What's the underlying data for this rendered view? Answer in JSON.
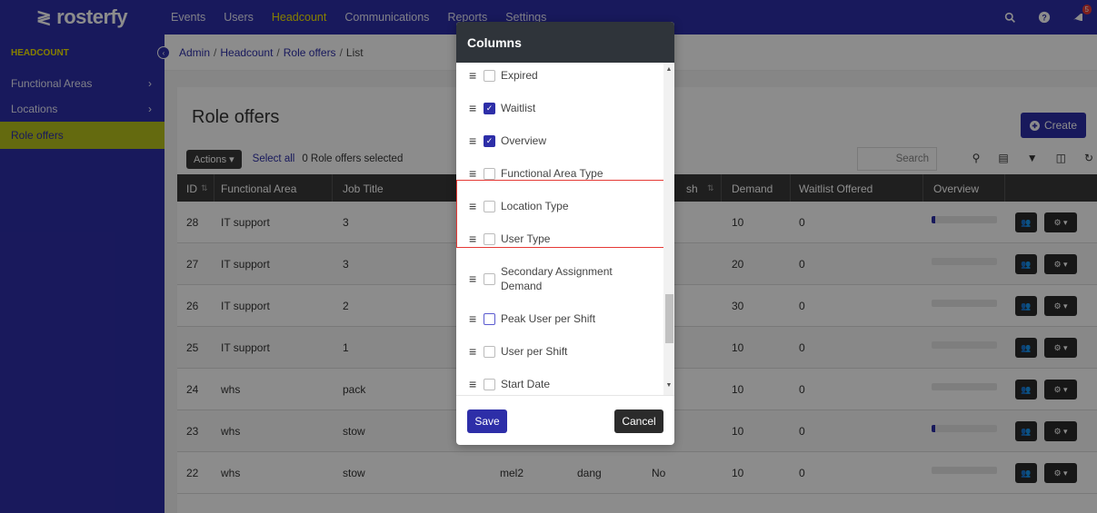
{
  "brand": {
    "name": "rosterfy"
  },
  "nav": {
    "items": [
      "Events",
      "Users",
      "Headcount",
      "Communications",
      "Reports",
      "Settings"
    ],
    "active": "Headcount"
  },
  "topbar": {
    "notification_count": "5"
  },
  "sidebar": {
    "heading": "HEADCOUNT",
    "items": [
      {
        "label": "Functional Areas",
        "arrow": "›"
      },
      {
        "label": "Locations",
        "arrow": "›"
      },
      {
        "label": "Role offers"
      }
    ]
  },
  "breadcrumb": {
    "admin": "Admin",
    "headcount": "Headcount",
    "role_offers": "Role offers",
    "list": "List"
  },
  "page": {
    "title": "Role offers",
    "create_label": "Create",
    "actions_label": "Actions ▾",
    "select_all_label": "Select all",
    "selected_text": "0 Role offers selected",
    "search_placeholder": "Search"
  },
  "table": {
    "headers": {
      "id": "ID",
      "functional_area": "Functional Area",
      "job_title": "Job Title",
      "col_partial": "sh",
      "demand": "Demand",
      "waitlist_offered": "Waitlist Offered",
      "overview": "Overview"
    },
    "rows": [
      {
        "id": "28",
        "area": "IT support",
        "job": "3",
        "demand": "10",
        "waitlist": "0",
        "progress": 0.06
      },
      {
        "id": "27",
        "area": "IT support",
        "job": "3",
        "demand": "20",
        "waitlist": "0",
        "progress": 0
      },
      {
        "id": "26",
        "area": "IT support",
        "job": "2",
        "demand": "30",
        "waitlist": "0",
        "progress": 0
      },
      {
        "id": "25",
        "area": "IT support",
        "job": "1",
        "demand": "10",
        "waitlist": "0",
        "progress": 0
      },
      {
        "id": "24",
        "area": "whs",
        "job": "pack",
        "demand": "10",
        "waitlist": "0",
        "progress": 0
      },
      {
        "id": "23",
        "area": "whs",
        "job": "stow",
        "demand": "10",
        "waitlist": "0",
        "progress": 0.06
      },
      {
        "id": "22",
        "area": "whs",
        "job": "stow",
        "location": "mel2",
        "loc2": "dang",
        "flag": "No",
        "demand": "10",
        "waitlist": "0",
        "progress": 0
      }
    ]
  },
  "modal": {
    "title": "Columns",
    "columns": [
      {
        "label": "Expired",
        "checked": false
      },
      {
        "label": "Waitlist",
        "checked": true
      },
      {
        "label": "Overview",
        "checked": true
      },
      {
        "label": "Functional Area Type",
        "checked": false
      },
      {
        "label": "Location Type",
        "checked": false
      },
      {
        "label": "User Type",
        "checked": false
      },
      {
        "label": "Secondary Assignment Demand",
        "checked": false
      },
      {
        "label": "Peak User per Shift",
        "checked": false
      },
      {
        "label": "User per Shift",
        "checked": false
      },
      {
        "label": "Start Date",
        "checked": false
      }
    ],
    "save_label": "Save",
    "cancel_label": "Cancel"
  },
  "colors": {
    "primary": "#2d2ea8",
    "accent": "#f2e600",
    "sidebar_active": "#b7c21c",
    "highlight": "#e53935"
  }
}
